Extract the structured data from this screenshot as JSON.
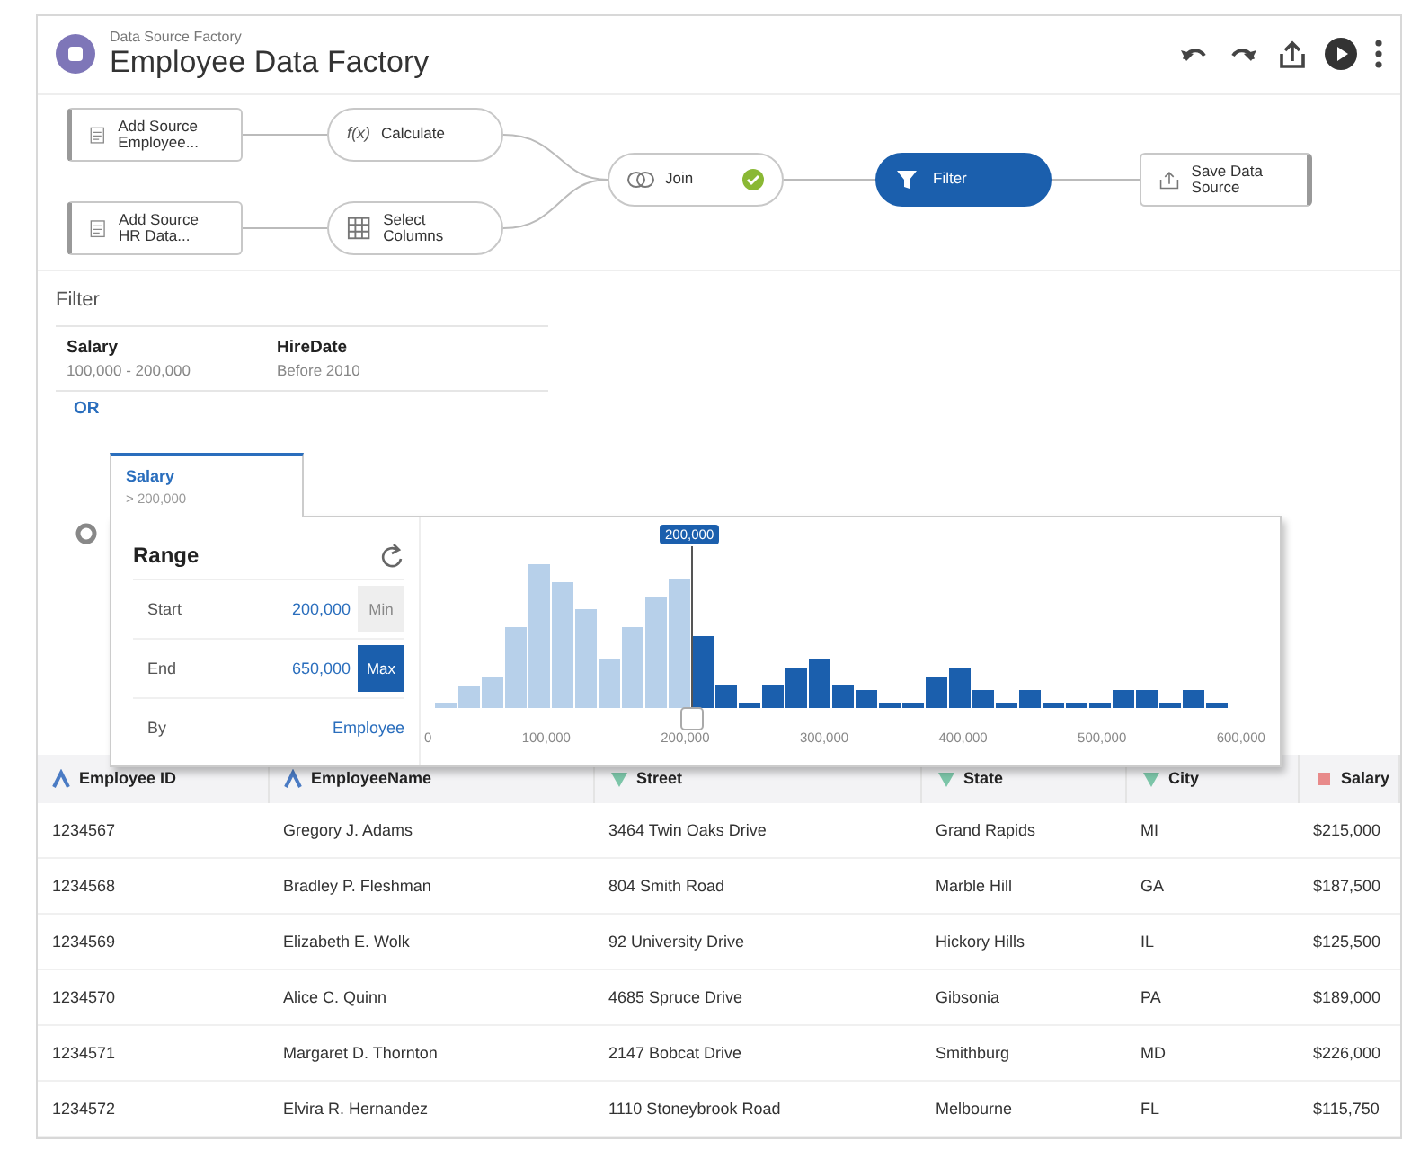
{
  "header": {
    "subtitle": "Data Source Factory",
    "title": "Employee Data Factory"
  },
  "pipeline": {
    "nodes": [
      {
        "kind": "source",
        "label": "Add Source Employee...",
        "selected": false
      },
      {
        "kind": "source",
        "label": "Add Source HR Data...",
        "selected": false
      },
      {
        "kind": "calculate",
        "glyph": "f(x)",
        "label": "Calculate",
        "selected": false
      },
      {
        "kind": "select",
        "label": "Select Columns",
        "selected": false
      },
      {
        "kind": "join",
        "label": "Join",
        "valid": true,
        "selected": false
      },
      {
        "kind": "filter",
        "label": "Filter",
        "selected": true
      },
      {
        "kind": "save",
        "label": "Save Data Source",
        "selected": false
      }
    ]
  },
  "filter": {
    "title": "Filter",
    "conditions": [
      {
        "field": "Salary",
        "value": "100,000 - 200,000"
      },
      {
        "field": "HireDate",
        "value": "Before 2010"
      }
    ],
    "operator": "OR",
    "active_tab": {
      "field": "Salary",
      "value": "> 200,000"
    }
  },
  "range": {
    "title": "Range",
    "rows": [
      {
        "label": "Start",
        "value": "200,000",
        "button": "Min",
        "selected": false
      },
      {
        "label": "End",
        "value": "650,000",
        "button": "Max",
        "selected": true
      },
      {
        "label": "By",
        "value": "Employee"
      }
    ],
    "histogram": {
      "marker": "200,000",
      "x_labels": [
        "0",
        "100,000",
        "200,000",
        "300,000",
        "400,000",
        "500,000",
        "600,000"
      ]
    }
  },
  "table": {
    "columns": [
      {
        "name": "Employee ID",
        "kind": "text"
      },
      {
        "name": "EmployeeName",
        "kind": "text"
      },
      {
        "name": "Street",
        "kind": "geo"
      },
      {
        "name": "State",
        "kind": "geo"
      },
      {
        "name": "City",
        "kind": "geo"
      },
      {
        "name": "Salary",
        "kind": "measure"
      }
    ],
    "rows": [
      [
        "1234567",
        "Gregory J. Adams",
        "3464 Twin Oaks Drive",
        "Grand Rapids",
        "MI",
        "$215,000"
      ],
      [
        "1234568",
        "Bradley P. Fleshman",
        "804 Smith Road",
        "Marble Hill",
        "GA",
        "$187,500"
      ],
      [
        "1234569",
        "Elizabeth E. Wolk",
        "92 University Drive",
        "Hickory Hills",
        "IL",
        "$125,500"
      ],
      [
        "1234570",
        "Alice C. Quinn",
        "4685 Spruce Drive",
        "Gibsonia",
        "PA",
        "$189,000"
      ],
      [
        "1234571",
        "Margaret D. Thornton",
        "2147 Bobcat Drive",
        "Smithburg",
        "MD",
        "$226,000"
      ],
      [
        "1234572",
        "Elvira R. Hernandez",
        "1110 Stoneybrook Road",
        "Melbourne",
        "FL",
        "$115,750"
      ]
    ]
  }
}
